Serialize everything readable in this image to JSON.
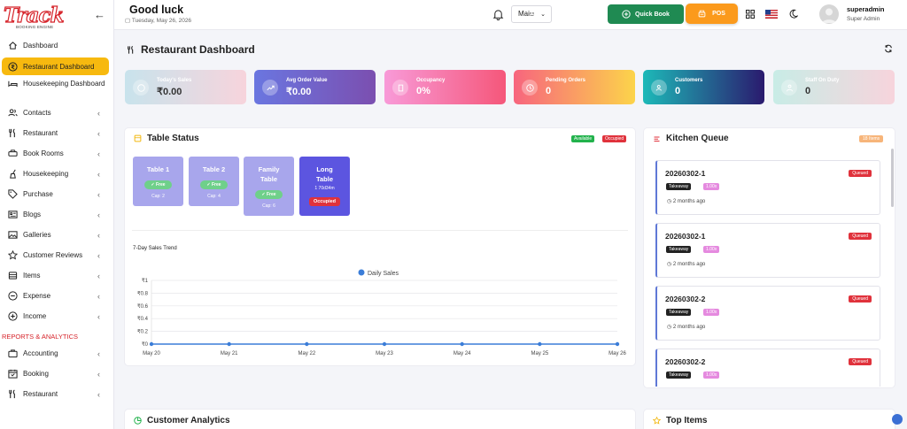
{
  "brand": {
    "logo": "Track",
    "logo_sub": "BOOKING ENGINE"
  },
  "sidebar": {
    "items": [
      {
        "label": "Dashboard",
        "icon": "home-icon",
        "chev": false
      },
      {
        "label": "Restaurant Dashboard",
        "icon": "rupee-icon",
        "chev": false,
        "active": true
      },
      {
        "label": "Housekeeping Dashboard",
        "icon": "bed-icon",
        "chev": false
      },
      {
        "label": "Contacts",
        "icon": "users-icon",
        "chev": true
      },
      {
        "label": "Restaurant",
        "icon": "utensils-icon",
        "chev": true
      },
      {
        "label": "Book Rooms",
        "icon": "car-icon",
        "chev": true
      },
      {
        "label": "Housekeeping",
        "icon": "broom-icon",
        "chev": true
      },
      {
        "label": "Purchase",
        "icon": "tag-icon",
        "chev": true
      },
      {
        "label": "Blogs",
        "icon": "newspaper-icon",
        "chev": true
      },
      {
        "label": "Galleries",
        "icon": "image-icon",
        "chev": true
      },
      {
        "label": "Customer Reviews",
        "icon": "star-icon",
        "chev": true
      },
      {
        "label": "Items",
        "icon": "box-icon",
        "chev": true
      },
      {
        "label": "Expense",
        "icon": "minus-circle-icon",
        "chev": true
      },
      {
        "label": "Income",
        "icon": "plus-circle-icon",
        "chev": true
      }
    ],
    "section": "REPORTS & ANALYTICS",
    "report_items": [
      {
        "label": "Accounting",
        "icon": "briefcase-icon",
        "chev": true
      },
      {
        "label": "Booking",
        "icon": "calendar-icon",
        "chev": true
      },
      {
        "label": "Restaurant",
        "icon": "utensils-icon",
        "chev": true
      }
    ]
  },
  "header": {
    "greeting": "Good luck",
    "date": "Tuesday, May 26, 2026",
    "language": "Maiೞ",
    "quick_book": "Quick Book",
    "pos": "POS",
    "username": "superadmin",
    "role": "Super Admin"
  },
  "page": {
    "title": "Restaurant Dashboard"
  },
  "stats": [
    {
      "label": "Today's Sales",
      "value": "₹0.00"
    },
    {
      "label": "Avg Order Value",
      "value": "₹0.00"
    },
    {
      "label": "Occupancy",
      "value": "0%"
    },
    {
      "label": "Pending Orders",
      "value": "0"
    },
    {
      "label": "Customers",
      "value": "0"
    },
    {
      "label": "Staff On Duty",
      "value": "0"
    }
  ],
  "table_status": {
    "title": "Table Status",
    "legend_available": "Available",
    "legend_occupied": "Occupied",
    "tables": [
      {
        "name": "Table 1",
        "status": "✓ Free",
        "cap": "Cap: 2"
      },
      {
        "name": "Table 2",
        "status": "✓ Free",
        "cap": "Cap: 4"
      },
      {
        "name": "Family Table",
        "status": "✓ Free",
        "cap": "Cap: 6"
      },
      {
        "name": "Long Table",
        "status": "Occupied",
        "sub": "1 70d34m"
      }
    ]
  },
  "chart_data": {
    "type": "line",
    "title": "7-Day Sales Trend",
    "categories": [
      "May 20",
      "May 21",
      "May 22",
      "May 23",
      "May 24",
      "May 25",
      "May 26"
    ],
    "series": [
      {
        "name": "Daily Sales",
        "values": [
          0,
          0,
          0,
          0,
          0,
          0,
          0
        ],
        "color": "#3b7dd8"
      }
    ],
    "yticks": [
      "₹0",
      "₹0.2",
      "₹0.4",
      "₹0.6",
      "₹0.8",
      "₹1"
    ],
    "ylim": [
      0,
      1
    ],
    "legend": "top-center",
    "grid": true
  },
  "kitchen": {
    "title": "Kitchen Queue",
    "count_badge": "18 Items",
    "orders": [
      {
        "id": "20260302-1",
        "status": "Queued",
        "type": "Takeaway",
        "amount": "1.00x",
        "ago": "2 months ago"
      },
      {
        "id": "20260302-1",
        "status": "Queued",
        "type": "Takeaway",
        "amount": "1.00x",
        "ago": "2 months ago"
      },
      {
        "id": "20260302-2",
        "status": "Queued",
        "type": "Takeaway",
        "amount": "1.00x",
        "ago": "2 months ago"
      },
      {
        "id": "20260302-2",
        "status": "Queued",
        "type": "Takeaway",
        "amount": "1.00x",
        "ago": "2 months ago"
      }
    ]
  },
  "bottom": {
    "customer_analytics": "Customer Analytics",
    "top_items": "Top Items"
  }
}
